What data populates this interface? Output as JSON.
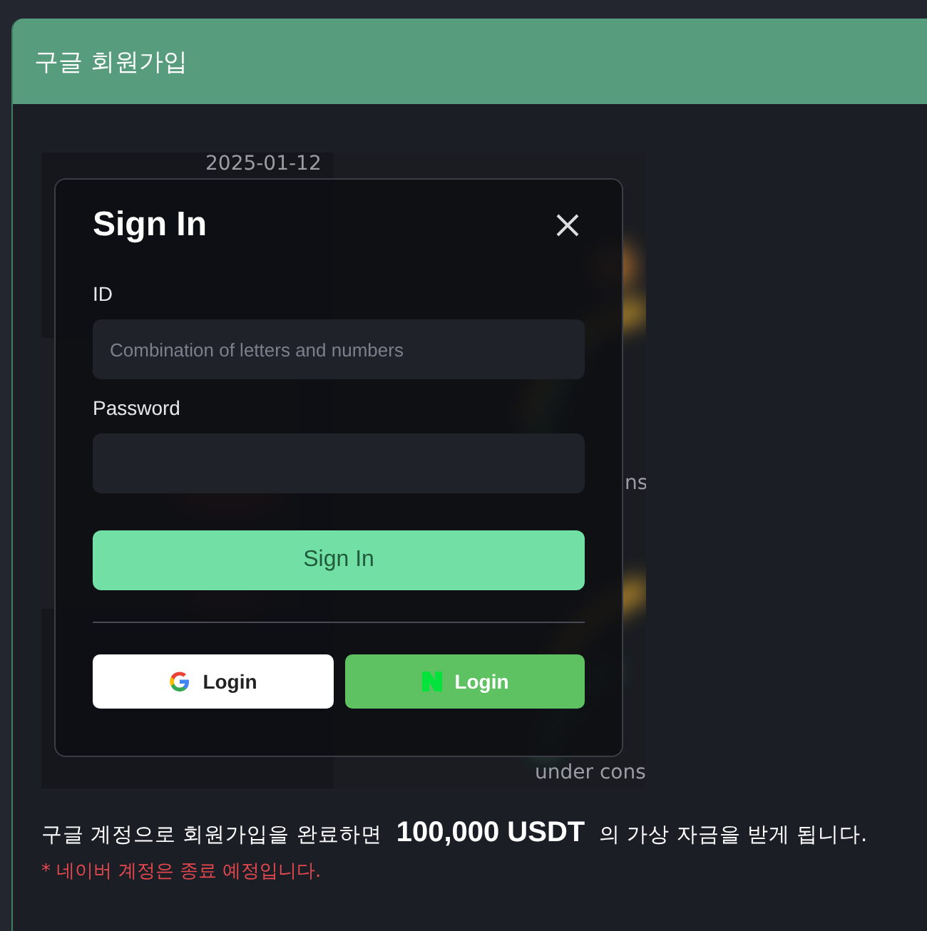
{
  "panel": {
    "title": "구글 회원가입"
  },
  "screenshot": {
    "backdrop_texts": [
      {
        "kind": "date",
        "text": "2025-01-12"
      },
      {
        "kind": "side",
        "text": "ns"
      },
      {
        "kind": "footer",
        "text": "under cons"
      }
    ],
    "modal": {
      "title": "Sign In",
      "fields": [
        {
          "label": "ID",
          "placeholder": "Combination of letters and numbers"
        },
        {
          "label": "Password"
        }
      ],
      "submit": "Sign In",
      "social": [
        {
          "kind": "google",
          "label": "Login"
        },
        {
          "kind": "naver",
          "label": "Login"
        }
      ]
    }
  },
  "notice": {
    "text": "구글 계정으로 회원가입을 완료하면",
    "amount": "100,000 USDT",
    "suffix": "의 가상 자금을 받게 됩니다."
  },
  "warning": "* 네이버 계정은 종료 예정입니다."
}
